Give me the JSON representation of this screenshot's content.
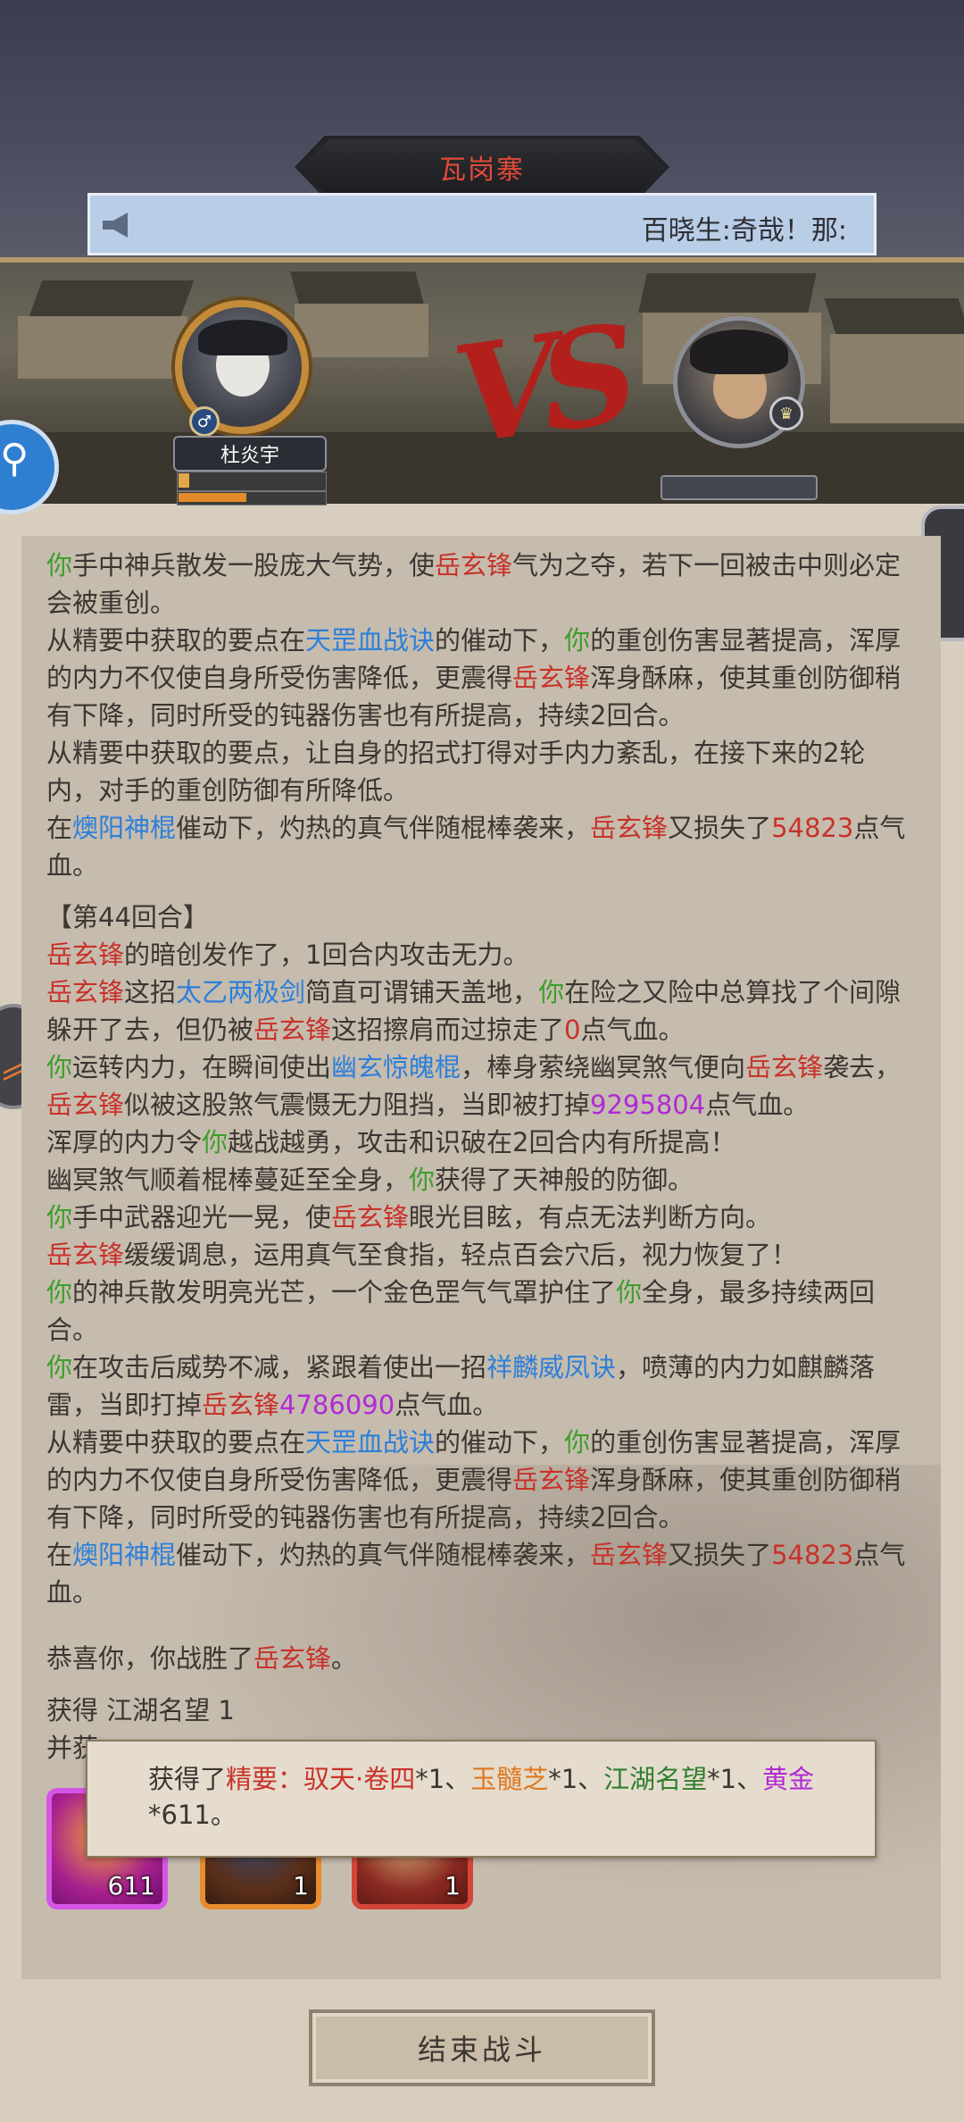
{
  "header": {
    "location_title": "瓦岗寨",
    "broadcast_icon": "megaphone-icon",
    "broadcast_text": "百晓生:奇哉！那:"
  },
  "battle": {
    "player_name": "杜炎宇",
    "player_gender_icon": "male-icon",
    "vs_text": "VS"
  },
  "log": {
    "line1": [
      {
        "t": "你",
        "c": "g"
      },
      {
        "t": "手中神兵散发一股庞大气势，使"
      },
      {
        "t": "岳玄锋",
        "c": "r"
      },
      {
        "t": "气为之夺，若下一回被击中则必定会被重创。"
      }
    ],
    "line2": [
      {
        "t": "从精要中获取的要点在"
      },
      {
        "t": "天罡血战诀",
        "c": "b"
      },
      {
        "t": "的催动下，"
      },
      {
        "t": "你",
        "c": "g"
      },
      {
        "t": "的重创伤害显著提高，浑厚的内力不仅使自身所受伤害降低，更震得"
      },
      {
        "t": "岳玄锋",
        "c": "r"
      },
      {
        "t": "浑身酥麻，使其重创防御稍有下降，同时所受的钝器伤害也有所提高，持续2回合。"
      }
    ],
    "line3": [
      {
        "t": "从精要中获取的要点，让自身的招式打得对手内力紊乱，在接下来的2轮内，对手的重创防御有所降低。"
      }
    ],
    "line4": [
      {
        "t": "在"
      },
      {
        "t": "燠阳神棍",
        "c": "b"
      },
      {
        "t": "催动下，灼热的真气伴随棍棒袭来，"
      },
      {
        "t": "岳玄锋",
        "c": "r"
      },
      {
        "t": "又损失了"
      },
      {
        "t": "54823",
        "c": "r"
      },
      {
        "t": "点气血。"
      }
    ],
    "round_header": "【第44回合】",
    "line5": [
      {
        "t": "岳玄锋",
        "c": "r"
      },
      {
        "t": "的暗创发作了，1回合内攻击无力。"
      }
    ],
    "line6": [
      {
        "t": "岳玄锋",
        "c": "r"
      },
      {
        "t": "这招"
      },
      {
        "t": "太乙两极剑",
        "c": "b"
      },
      {
        "t": "简直可谓铺天盖地，"
      },
      {
        "t": "你",
        "c": "g"
      },
      {
        "t": "在险之又险中总算找了个间隙躲开了去，但仍被"
      },
      {
        "t": "岳玄锋",
        "c": "r"
      },
      {
        "t": "这招擦肩而过掠走了"
      },
      {
        "t": "0",
        "c": "r"
      },
      {
        "t": "点气血。"
      }
    ],
    "line7": [
      {
        "t": "你",
        "c": "g"
      },
      {
        "t": "运转内力，在瞬间使出"
      },
      {
        "t": "幽玄惊魄棍",
        "c": "b"
      },
      {
        "t": "，棒身萦绕幽冥煞气便向"
      },
      {
        "t": "岳玄锋",
        "c": "r"
      },
      {
        "t": "袭去，"
      },
      {
        "t": "岳玄锋",
        "c": "r"
      },
      {
        "t": "似被这股煞气震慑无力阻挡，当即被打掉"
      },
      {
        "t": "9295804",
        "c": "p"
      },
      {
        "t": "点气血。"
      }
    ],
    "line8": [
      {
        "t": "浑厚的内力令"
      },
      {
        "t": "你",
        "c": "g"
      },
      {
        "t": "越战越勇，攻击和识破在2回合内有所提高！"
      }
    ],
    "line9": [
      {
        "t": "幽冥煞气顺着棍棒蔓延至全身，"
      },
      {
        "t": "你",
        "c": "g"
      },
      {
        "t": "获得了天神般的防御。"
      }
    ],
    "line10": [
      {
        "t": "你",
        "c": "g"
      },
      {
        "t": "手中武器迎光一晃，使"
      },
      {
        "t": "岳玄锋",
        "c": "r"
      },
      {
        "t": "眼光目眩，有点无法判断方向。"
      }
    ],
    "line11": [
      {
        "t": "岳玄锋",
        "c": "r"
      },
      {
        "t": "缓缓调息，运用真气至食指，轻点百会穴后，视力恢复了！"
      }
    ],
    "line12": [
      {
        "t": "你",
        "c": "g"
      },
      {
        "t": "的神兵散发明亮光芒，一个金色罡气气罩护住了"
      },
      {
        "t": "你",
        "c": "g"
      },
      {
        "t": "全身，最多持续两回合。"
      }
    ],
    "line13": [
      {
        "t": "你",
        "c": "g"
      },
      {
        "t": "在攻击后威势不减，紧跟着使出一招"
      },
      {
        "t": "祥麟威凤诀",
        "c": "b"
      },
      {
        "t": "，喷薄的内力如麒麟落雷，当即打掉"
      },
      {
        "t": "岳玄锋",
        "c": "r"
      },
      {
        "t": "4786090",
        "c": "p"
      },
      {
        "t": "点气血。"
      }
    ],
    "line14": [
      {
        "t": "从精要中获取的要点在"
      },
      {
        "t": "天罡血战诀",
        "c": "b"
      },
      {
        "t": "的催动下，"
      },
      {
        "t": "你",
        "c": "g"
      },
      {
        "t": "的重创伤害显著提高，浑厚的内力不仅使自身所受伤害降低，更震得"
      },
      {
        "t": "岳玄锋",
        "c": "r"
      },
      {
        "t": "浑身酥麻，使其重创防御稍有下降，同时所受的钝器伤害也有所提高，持续2回合。"
      }
    ],
    "line15": [
      {
        "t": "在"
      },
      {
        "t": "燠阳神棍",
        "c": "b"
      },
      {
        "t": "催动下，灼热的真气伴随棍棒袭来，"
      },
      {
        "t": "岳玄锋",
        "c": "r"
      },
      {
        "t": "又损失了"
      },
      {
        "t": "54823",
        "c": "r"
      },
      {
        "t": "点气血。"
      }
    ],
    "victory": [
      {
        "t": "恭喜你，你战胜了"
      },
      {
        "t": "岳玄锋",
        "c": "r"
      },
      {
        "t": "。"
      }
    ],
    "reward_line": "获得 江湖名望 1",
    "reward_line2_prefix": "并获"
  },
  "rewards": [
    {
      "name": "gold-ingot-item",
      "count": "611"
    },
    {
      "name": "herb-item",
      "count": "1"
    },
    {
      "name": "manual-book-item",
      "count": "1"
    }
  ],
  "toast": [
    {
      "t": "获得了"
    },
    {
      "t": "精要：驭天·卷四",
      "c": "r"
    },
    {
      "t": "*1、"
    },
    {
      "t": "玉髓芝",
      "c": "o"
    },
    {
      "t": "*1、"
    },
    {
      "t": "江湖名望",
      "c": "gr"
    },
    {
      "t": "*1、"
    },
    {
      "t": "黄金",
      "c": "p"
    },
    {
      "t": "*611。"
    }
  ],
  "end_button_label": "结束战斗",
  "colors": {
    "you": "#3d9e2c",
    "enemy": "#c8322a",
    "skill": "#2d7fd8",
    "big_damage": "#b02ad6"
  }
}
